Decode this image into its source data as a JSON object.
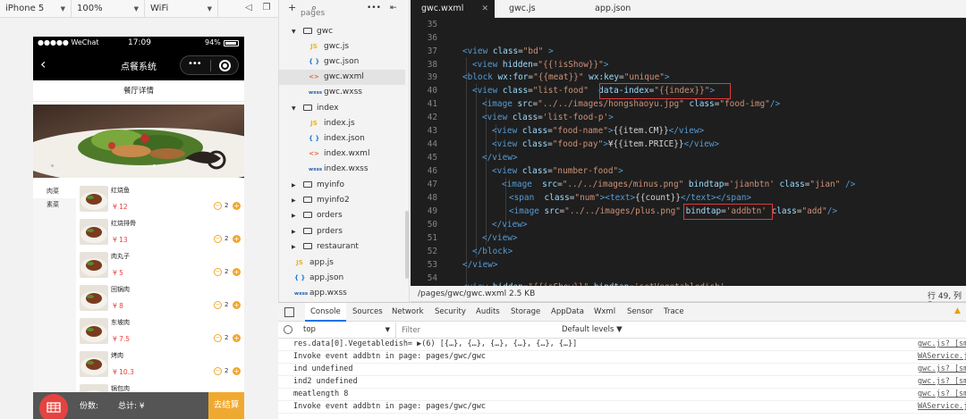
{
  "simulator": {
    "device": "iPhone 5",
    "zoom": "100%",
    "network": "WiFi",
    "status_bar": {
      "carrier": "●●●●● WeChat",
      "time": "17:09",
      "battery": "94%"
    },
    "nav_title": "点餐系统",
    "page_title": "餐厅详情",
    "categories": [
      "肉菜",
      "素菜"
    ],
    "foods": [
      {
        "name": "红烧鱼",
        "price": "¥ 12",
        "count": "2"
      },
      {
        "name": "红烧排骨",
        "price": "¥ 13",
        "count": "2"
      },
      {
        "name": "肉丸子",
        "price": "¥ 5",
        "count": "2"
      },
      {
        "name": "回锅肉",
        "price": "¥ 8",
        "count": "2"
      },
      {
        "name": "东坡肉",
        "price": "¥ 7.5",
        "count": "2"
      },
      {
        "name": "烤肉",
        "price": "¥ 10.3",
        "count": "2"
      },
      {
        "name": "锅包肉",
        "price": "",
        "count": ""
      }
    ],
    "cart": {
      "count_label": "份数:",
      "total_label": "总计: ¥",
      "checkout": "去结算"
    }
  },
  "explorer": {
    "items": [
      {
        "label": "pages",
        "type": "folder"
      },
      {
        "label": "gwc",
        "type": "folder"
      },
      {
        "label": "gwc.js",
        "type": "js",
        "icon": "JS"
      },
      {
        "label": "gwc.json",
        "type": "json",
        "icon": "{ }"
      },
      {
        "label": "gwc.wxml",
        "type": "wxml",
        "icon": "<>"
      },
      {
        "label": "gwc.wxss",
        "type": "wxss",
        "icon": "wxss"
      },
      {
        "label": "index",
        "type": "folder"
      },
      {
        "label": "index.js",
        "type": "js",
        "icon": "JS"
      },
      {
        "label": "index.json",
        "type": "json",
        "icon": "{ }"
      },
      {
        "label": "index.wxml",
        "type": "wxml",
        "icon": "<>"
      },
      {
        "label": "index.wxss",
        "type": "wxss",
        "icon": "wxss"
      },
      {
        "label": "myinfo",
        "type": "folder"
      },
      {
        "label": "myinfo2",
        "type": "folder"
      },
      {
        "label": "orders",
        "type": "folder"
      },
      {
        "label": "prders",
        "type": "folder"
      },
      {
        "label": "restaurant",
        "type": "folder"
      },
      {
        "label": "app.js",
        "type": "js",
        "icon": "JS"
      },
      {
        "label": "app.json",
        "type": "json",
        "icon": "{ }"
      },
      {
        "label": "app.wxss",
        "type": "wxss",
        "icon": "wxss"
      }
    ]
  },
  "editor": {
    "tabs": [
      "gwc.wxml",
      "gwc.js",
      "app.json"
    ],
    "line_numbers": [
      "35",
      "36",
      "37",
      "38",
      "39",
      "40",
      "41",
      "42",
      "43",
      "44",
      "45",
      "46",
      "47",
      "48",
      "49",
      "50",
      "51",
      "52",
      "53",
      "54"
    ],
    "status_path": "/pages/gwc/gwc.wxml",
    "status_size": "2.5 KB",
    "status_pos": "行 49, 列 5"
  },
  "devtools": {
    "tabs": [
      "Console",
      "Sources",
      "Network",
      "Security",
      "Audits",
      "Storage",
      "AppData",
      "Wxml",
      "Sensor",
      "Trace"
    ],
    "context": "top",
    "filter_placeholder": "Filter",
    "levels": "Default levels ▼",
    "logs": [
      {
        "msg": "res.data[0].Vegetabledish= ▶(6) [{…}, {…}, {…}, {…}, {…}, {…}]",
        "src": "gwc.js? [sm]"
      },
      {
        "msg": "Invoke event addbtn in page: pages/gwc/gwc",
        "src": "WAService.js"
      },
      {
        "msg": "ind undefined",
        "src": "gwc.js? [sm]"
      },
      {
        "msg": "ind2 undefined",
        "src": "gwc.js? [sm]"
      },
      {
        "msg": "meatlength 8",
        "src": "gwc.js? [sm]"
      },
      {
        "msg": "Invoke event addbtn in page: pages/gwc/gwc",
        "src": "WAService.js"
      }
    ]
  },
  "colors": {
    "accent": "#f3a62b",
    "price": "#e64340",
    "highlight": "#e03a3a"
  }
}
